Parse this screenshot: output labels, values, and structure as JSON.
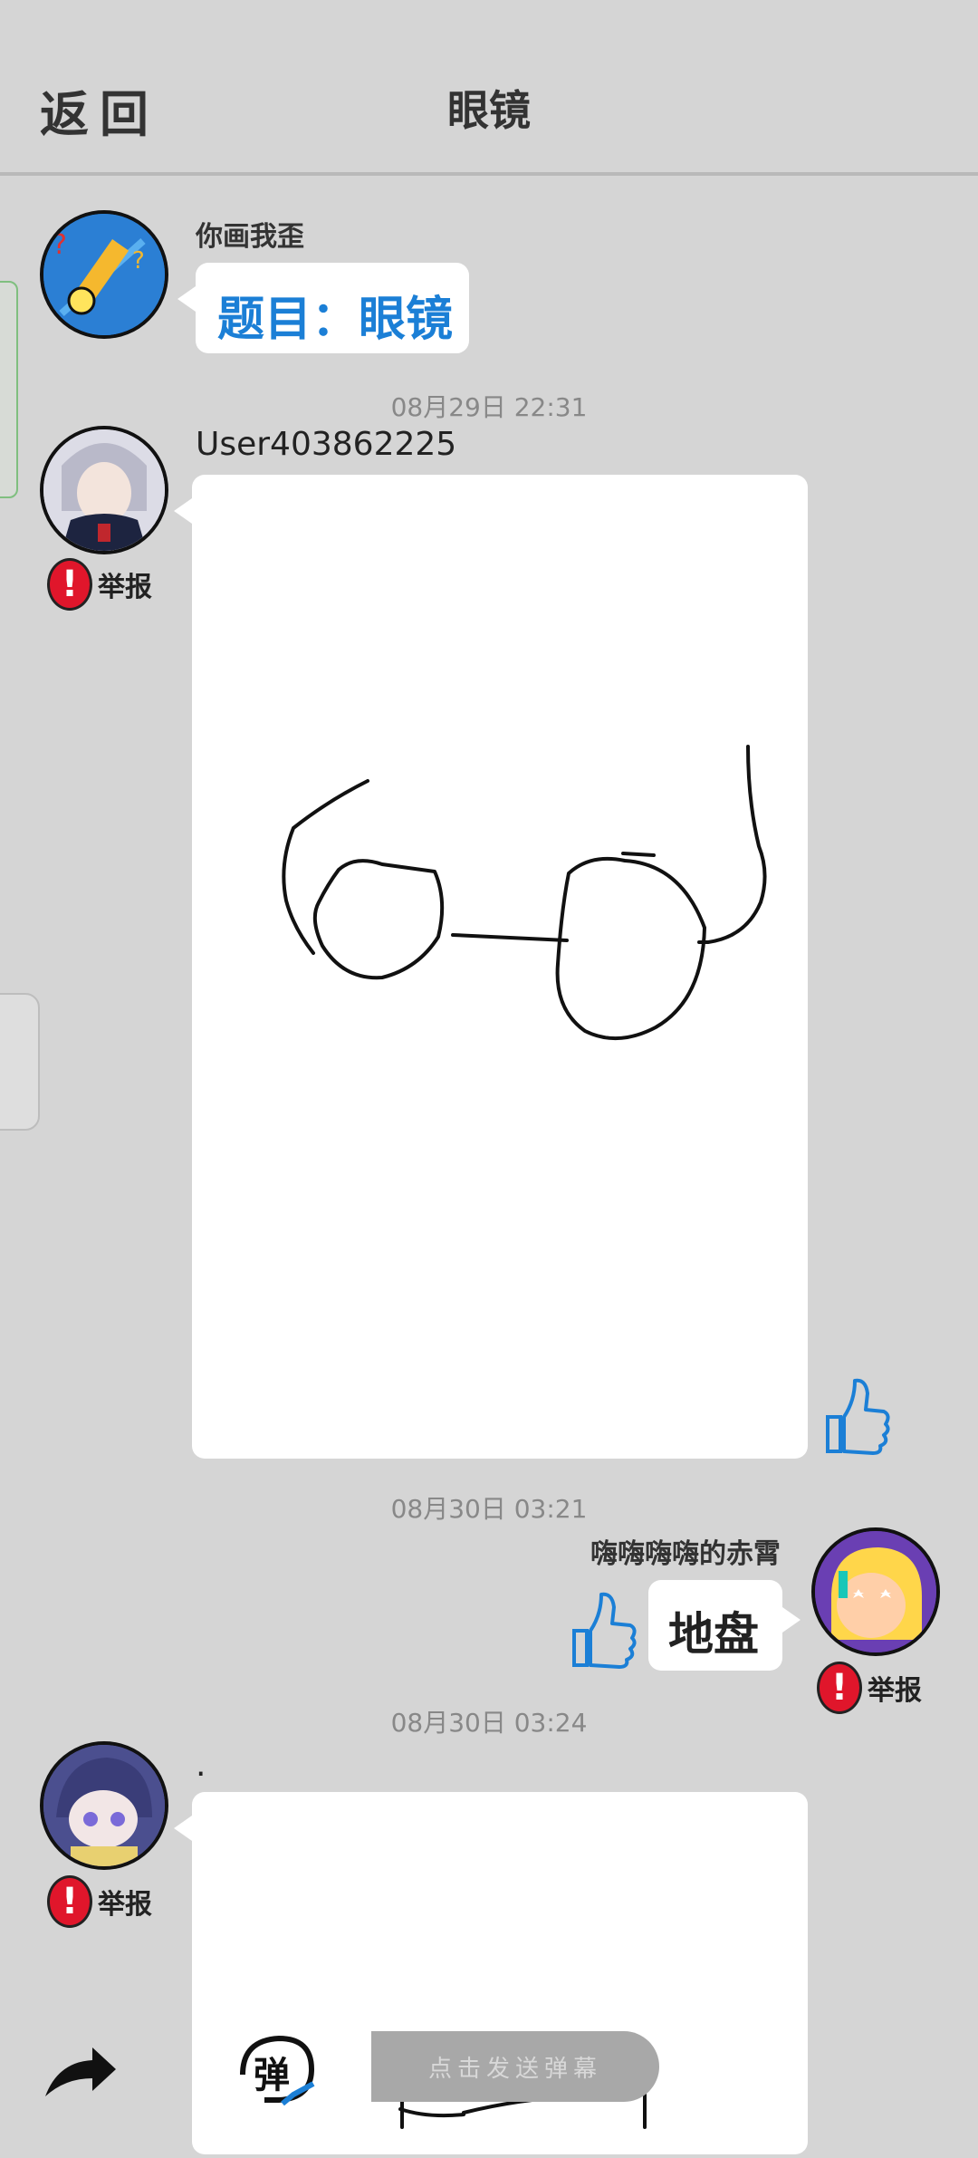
{
  "header": {
    "back_label": "返回",
    "title": "眼镜"
  },
  "messages": [
    {
      "sender": "你画我歪",
      "text": "题目：眼镜"
    },
    {
      "timestamp": "08月29日  22:31",
      "sender": "User403862225",
      "report_label": "举报"
    },
    {
      "timestamp": "08月30日  03:21",
      "sender": "嗨嗨嗨嗨的赤霄",
      "text": "地盘",
      "report_label": "举报"
    },
    {
      "timestamp": "08月30日  03:24",
      "sender": ".",
      "report_label": "举报"
    }
  ],
  "bottom_bar": {
    "danmaku_icon_text": "弹",
    "danmaku_placeholder": "点击发送弹幕"
  },
  "colors": {
    "background": "#d5d5d5",
    "accent_blue": "#1b7fd6",
    "report_red": "#e0162b"
  },
  "icons": [
    "back-text",
    "thumbs-up-icon",
    "report-icon",
    "share-arrow-icon",
    "danmaku-icon"
  ]
}
